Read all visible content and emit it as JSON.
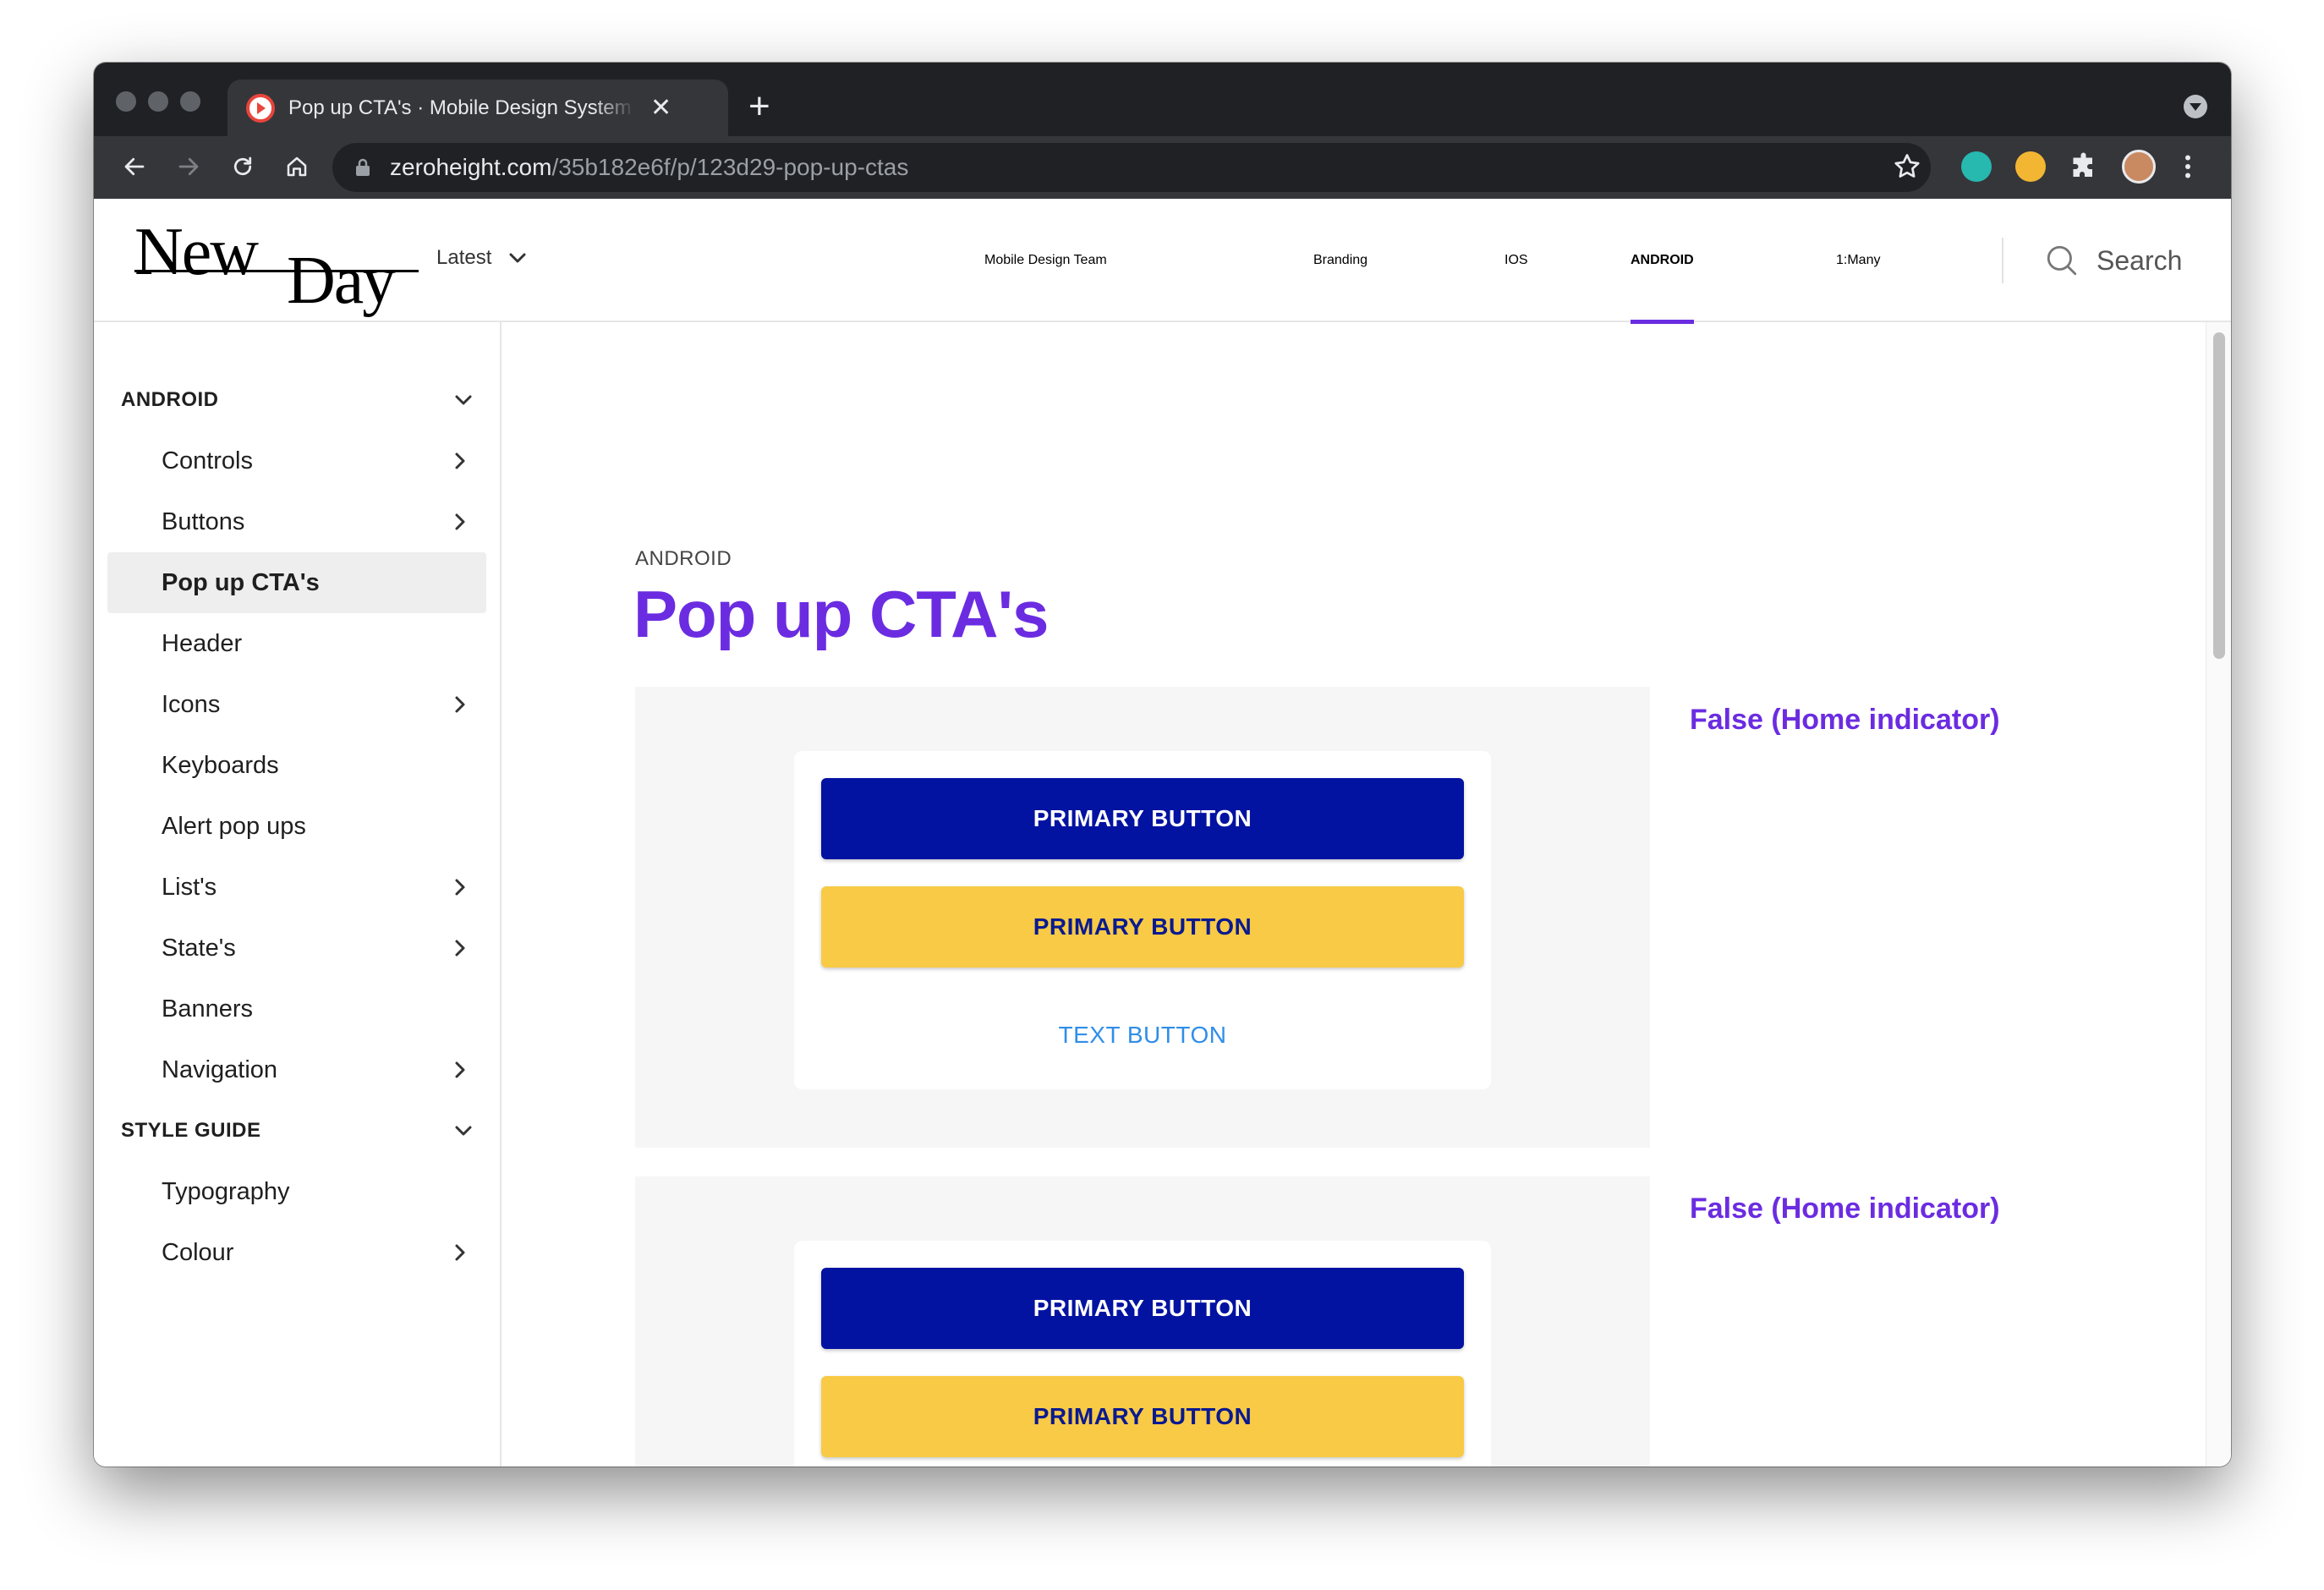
{
  "browser": {
    "tab_title": "Pop up CTA's · Mobile Design System",
    "url_host": "zeroheight.com",
    "url_path": "/35b182e6f/p/123d29-pop-up-ctas"
  },
  "header": {
    "logo_word1": "New",
    "logo_word2": "Day",
    "version_label": "Latest",
    "nav": [
      {
        "label": "Mobile Design Team"
      },
      {
        "label": "Branding"
      },
      {
        "label": "IOS"
      },
      {
        "label": "ANDROID"
      },
      {
        "label": "1:Many"
      }
    ],
    "search_label": "Search"
  },
  "sidebar": {
    "groups": [
      {
        "label": "ANDROID"
      },
      {
        "label": "STYLE GUIDE"
      }
    ],
    "items": [
      {
        "label": "Controls"
      },
      {
        "label": "Buttons"
      },
      {
        "label": "Pop up CTA's"
      },
      {
        "label": "Header"
      },
      {
        "label": "Icons"
      },
      {
        "label": "Keyboards"
      },
      {
        "label": "Alert pop ups"
      },
      {
        "label": "List's"
      },
      {
        "label": "State's"
      },
      {
        "label": "Banners"
      },
      {
        "label": "Navigation"
      },
      {
        "label": "Typography"
      },
      {
        "label": "Colour"
      }
    ]
  },
  "content": {
    "category": "ANDROID",
    "title": "Pop up CTA's",
    "examples": [
      {
        "label": "False (Home indicator)",
        "primary_button": "PRIMARY BUTTON",
        "secondary_button": "PRIMARY BUTTON",
        "text_button": "TEXT BUTTON"
      },
      {
        "label": "False (Home indicator)",
        "primary_button": "PRIMARY BUTTON",
        "secondary_button": "PRIMARY BUTTON"
      }
    ]
  },
  "colors": {
    "accent": "#6b2ce1",
    "primary_button": "#0212a1",
    "secondary_button": "#f8ca45",
    "text_button": "#2f8ee8"
  }
}
